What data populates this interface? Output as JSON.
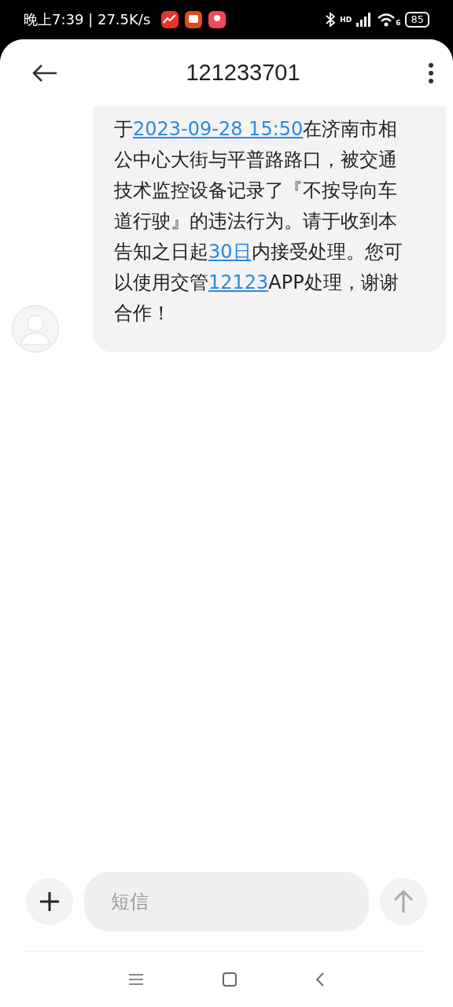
{
  "status_bar": {
    "time": "晚上7:39 | 27.5K/s",
    "signal_label": "HD",
    "wifi_label": "6",
    "battery": "85"
  },
  "header": {
    "title": "121233701"
  },
  "message": {
    "segments": [
      {
        "kind": "text",
        "text": "于"
      },
      {
        "kind": "link",
        "text": "2023-09-28 15:50"
      },
      {
        "kind": "text",
        "text": "在济南市相公中心大街与平普路路口，被交通技术监控设备记录了『不按导向车道行驶』的违法行为。请于收到本告知之日起"
      },
      {
        "kind": "link",
        "text": "30日"
      },
      {
        "kind": "text",
        "text": "内接受处理。您可以使用交管"
      },
      {
        "kind": "link",
        "text": "12123"
      },
      {
        "kind": "text",
        "text": "APP处理，谢谢合作！"
      }
    ]
  },
  "compose": {
    "placeholder": "短信"
  }
}
